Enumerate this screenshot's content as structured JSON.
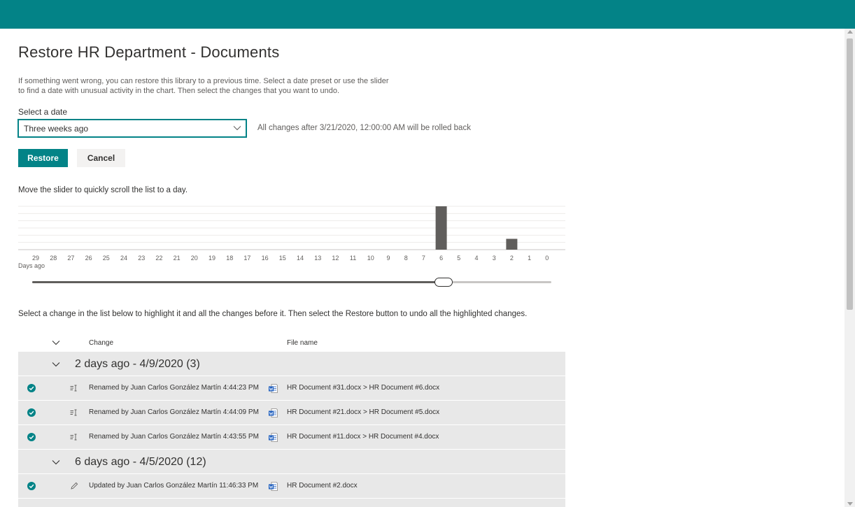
{
  "page": {
    "title": "Restore HR Department - Documents",
    "intro": "If something went wrong, you can restore this library to a previous time. Select a date preset or use the slider to find a date with unusual activity in the chart. Then select the changes that you want to undo."
  },
  "date_picker": {
    "label": "Select a date",
    "selected": "Three weeks ago",
    "note": "All changes after 3/21/2020, 12:00:00 AM will be rolled back"
  },
  "actions": {
    "restore_label": "Restore",
    "cancel_label": "Cancel"
  },
  "slider": {
    "hint": "Move the slider to quickly scroll the list to a day.",
    "days_ago_label": "Days ago",
    "value_days_ago": 6,
    "max_days_ago": 29
  },
  "chart_data": {
    "type": "bar",
    "categories": [
      "29",
      "28",
      "27",
      "26",
      "25",
      "24",
      "23",
      "22",
      "21",
      "20",
      "19",
      "18",
      "17",
      "16",
      "15",
      "14",
      "13",
      "12",
      "11",
      "10",
      "9",
      "8",
      "7",
      "6",
      "5",
      "4",
      "3",
      "2",
      "1",
      "0"
    ],
    "values": [
      0,
      0,
      0,
      0,
      0,
      0,
      0,
      0,
      0,
      0,
      0,
      0,
      0,
      0,
      0,
      0,
      0,
      0,
      0,
      0,
      0,
      0,
      0,
      12,
      0,
      0,
      0,
      3,
      0,
      0
    ],
    "xlabel": "Days ago",
    "ylabel": "",
    "ylim": [
      0,
      12
    ],
    "grid": true,
    "bar_color": "#605e5c"
  },
  "list": {
    "hint": "Select a change in the list below to highlight it and all the changes before it. Then select the Restore button to undo all the highlighted changes.",
    "col_change": "Change",
    "col_file": "File name",
    "groups": [
      {
        "title": "2 days ago - 4/9/2020 (3)",
        "rows": [
          {
            "action_icon": "rename-icon",
            "change": "Renamed by Juan Carlos González Martín 4:44:23 PM",
            "file": "HR Document #31.docx > HR Document #6.docx"
          },
          {
            "action_icon": "rename-icon",
            "change": "Renamed by Juan Carlos González Martín 4:44:09 PM",
            "file": "HR Document #21.docx > HR Document #5.docx"
          },
          {
            "action_icon": "rename-icon",
            "change": "Renamed by Juan Carlos González Martín 4:43:55 PM",
            "file": "HR Document #11.docx > HR Document #4.docx"
          }
        ]
      },
      {
        "title": "6 days ago - 4/5/2020 (12)",
        "rows": [
          {
            "action_icon": "edit-icon",
            "change": "Updated by Juan Carlos González Martín 11:46:33 PM",
            "file": "HR Document #2.docx"
          }
        ]
      }
    ]
  },
  "colors": {
    "accent": "#038387",
    "row_bg": "#e8e8e8",
    "word_blue": "#185abd"
  }
}
